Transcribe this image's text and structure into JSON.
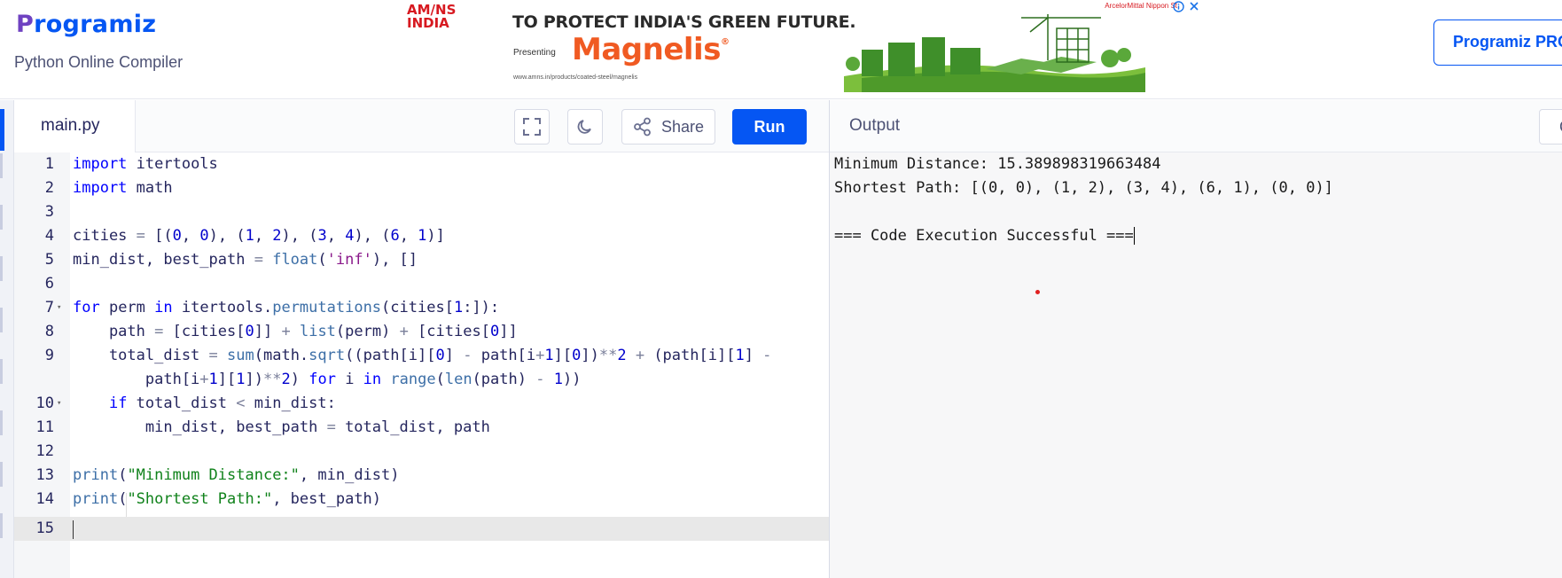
{
  "header": {
    "logo_text": "rogramiz",
    "logo_mark": "P",
    "subtitle": "Python Online Compiler",
    "pro_button": "Programiz PRO"
  },
  "ad": {
    "brand": "AM/NS INDIA",
    "headline": "TO PROTECT INDIA'S GREEN FUTURE.",
    "presenting": "Presenting",
    "product": "Magnelis",
    "product_mark": "®",
    "url": "www.amns.in/products/coated-steel/magnelis",
    "corner": "ArcelorMittal Nippon St",
    "icons": [
      "info-icon",
      "close-icon"
    ]
  },
  "editor": {
    "tab": "main.py",
    "share_label": "Share",
    "run_label": "Run",
    "line_numbers": [
      "1",
      "2",
      "3",
      "4",
      "5",
      "6",
      "7",
      "8",
      "9",
      "",
      "10",
      "11",
      "12",
      "13",
      "14",
      "15"
    ]
  },
  "output": {
    "title": "Output",
    "clear_label": "Clear",
    "lines": [
      "Minimum Distance: 15.389898319663484",
      "Shortest Path: [(0, 0), (1, 2), (3, 4), (6, 1), (0, 0)]",
      "",
      "=== Code Execution Successful ==="
    ]
  },
  "colors": {
    "accent": "#0556f3",
    "keyword": "#0000ff",
    "string": "#10821b"
  }
}
